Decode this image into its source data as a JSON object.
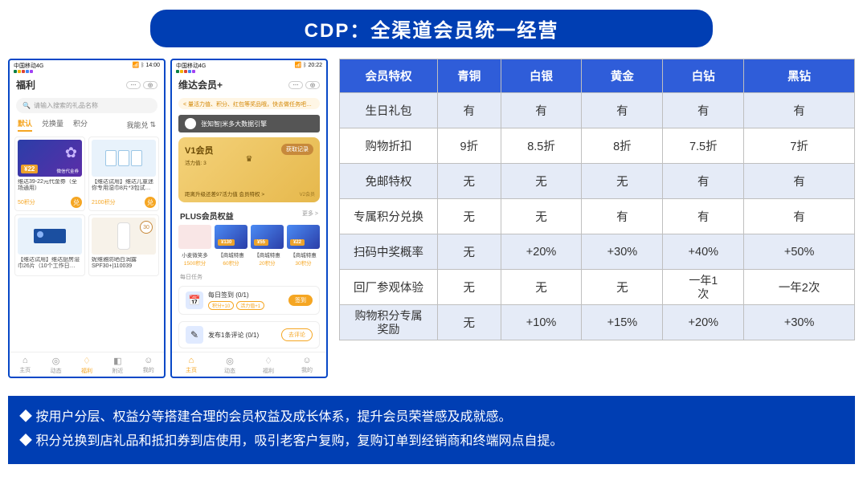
{
  "title": "CDP：全渠道会员统一经营",
  "phone1": {
    "statusbar_left": "中国移动4G",
    "statusbar_time": "14:00",
    "page_title": "福利",
    "search_placeholder": "请输入搜索的礼品名称",
    "tabs": {
      "t1": "默认",
      "t2": "兑换量",
      "t3": "积分",
      "t4": "我能兑"
    },
    "cards": [
      {
        "name": "维达39-22元代金券（全场通用）",
        "points": "50积分",
        "badge": "¥22",
        "footnote": "微信代金券",
        "bg": "linear-gradient(135deg,#2b3ea8,#5b2ea8)"
      },
      {
        "name": "【维达试用】维达儿童迷你专用湿巾8片*3包试…",
        "points": "2100积分",
        "bg": "#e0ecf7"
      },
      {
        "name": "【维达试用】维达厨房湿巾26片（10个工作日…",
        "points": "",
        "bg": "#e0ecf7"
      },
      {
        "name": "妮维雅防晒白润露SPF30+|110039",
        "points": "",
        "badge30": "30",
        "bg": "#f7f2e9"
      }
    ],
    "nav": [
      {
        "label": "主页",
        "icon": "⌂"
      },
      {
        "label": "动态",
        "icon": "◎"
      },
      {
        "label": "福利",
        "icon": "♢",
        "active": true
      },
      {
        "label": "附近",
        "icon": "◧"
      },
      {
        "label": "我的",
        "icon": "☺"
      }
    ]
  },
  "phone2": {
    "statusbar_left": "中国移动4G",
    "statusbar_time": "20:22",
    "page_title": "维达会员+",
    "notice": "< 量活力值、积分、红包等奖品哦，快去做任务吧…",
    "brand": "张知智|米多大数据引擎",
    "vip": {
      "level": "V1会员",
      "vitality": "活力值: 3",
      "btn": "获取记录",
      "bottom": "距离升级还差97活力值  会员特权 >",
      "corner": "V2会员"
    },
    "plus_title": "PLUS会员权益",
    "more": "更多 >",
    "plus_items": [
      {
        "title": "小麦微笑多格…",
        "points": "1500积分",
        "price": "",
        "bg": "#f9e6e6"
      },
      {
        "title": "【商城特惠GO…",
        "points": "60积分",
        "price": "¥130",
        "bg": "linear-gradient(135deg,#4b8bf4,#2b3ea8)"
      },
      {
        "title": "【商城特惠GO…",
        "points": "20积分",
        "price": "¥55",
        "bg": "linear-gradient(135deg,#4b8bf4,#2b3ea8)"
      },
      {
        "title": "【商城特惠GO…",
        "points": "30积分",
        "price": "¥22",
        "bg": "linear-gradient(135deg,#4b8bf4,#2b3ea8)"
      }
    ],
    "tasks_title": "每日任务",
    "task1": {
      "title": "每日签到 (0/1)",
      "tags": [
        "积分+10",
        "活力值+1"
      ],
      "btn": "签到"
    },
    "task2": {
      "title": "发布1条评论 (0/1)",
      "btn": "去评论"
    },
    "nav": [
      {
        "label": "主页",
        "icon": "⌂",
        "active": true
      },
      {
        "label": "动态",
        "icon": "◎"
      },
      {
        "label": "福利",
        "icon": "♢"
      },
      {
        "label": "我的",
        "icon": "☺"
      }
    ]
  },
  "table": {
    "headers": [
      "会员特权",
      "青铜",
      "白银",
      "黄金",
      "白钻",
      "黑钻"
    ],
    "rows": [
      [
        "生日礼包",
        "有",
        "有",
        "有",
        "有",
        "有"
      ],
      [
        "购物折扣",
        "9折",
        "8.5折",
        "8折",
        "7.5折",
        "7折"
      ],
      [
        "免邮特权",
        "无",
        "无",
        "无",
        "有",
        "有"
      ],
      [
        "专属积分兑换",
        "无",
        "无",
        "有",
        "有",
        "有"
      ],
      [
        "扫码中奖概率",
        "无",
        "+20%",
        "+30%",
        "+40%",
        "+50%"
      ],
      [
        "回厂参观体验",
        "无",
        "无",
        "无",
        "一年1次",
        "一年2次"
      ],
      [
        "购物积分专属奖励",
        "无",
        "+10%",
        "+15%",
        "+20%",
        "+30%"
      ]
    ]
  },
  "bullets": [
    "按用户分层、权益分等搭建合理的会员权益及成长体系，提升会员荣誉感及成就感。",
    "积分兑换到店礼品和抵扣券到店使用，吸引老客户复购，复购订单到经销商和终端网点自提。"
  ]
}
